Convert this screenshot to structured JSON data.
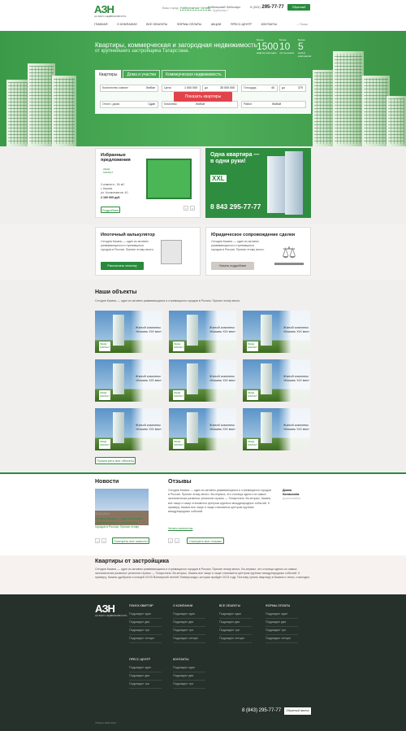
{
  "header": {
    "logo": "АЗН",
    "logo_sub": "АК БАРС НЕДВИЖИМОСТЬ",
    "city_label": "Ваш город:",
    "city_value": "Набережные Челны",
    "address": "Кобельский Лабсхирс",
    "address_sub": "Ул. Курбатова 7",
    "phone_code": "8 (843)",
    "phone": "295-77-77",
    "callback": "Обратный звонок",
    "nav": [
      "ГЛАВНАЯ",
      "О КОМПАНИИ",
      "ВСЕ ОБЪЕКТЫ",
      "ФОРМЫ ОПЛАТЫ",
      "АКЦИИ",
      "ПРЕСС-ЦЕНТР",
      "КОНТАКТЫ"
    ],
    "search": "Поиск"
  },
  "hero": {
    "title": "Квартиры, коммерческая и загородная недвижимость",
    "subtitle": "от крупнейшего застройщика Татарстана.",
    "stats": [
      {
        "label": "Более",
        "number": "1500",
        "unit": "квартир ежегодно"
      },
      {
        "label": "Более",
        "number": "10",
        "unit": "лет на рынке"
      },
      {
        "label": "Более",
        "number": "5",
        "unit": "жилых комплексов"
      }
    ],
    "tabs": [
      "Квартиры",
      "Дома и участки",
      "Коммерческая недвижимость"
    ],
    "filters": {
      "rooms_label": "Количество комнат",
      "rooms_value": "Любое",
      "price_label": "Цена",
      "price_from": "1 000 000",
      "price_to_label": "до",
      "price_to": "35 000 000",
      "area_label": "Площадь",
      "area_from": "40",
      "area_to_label": "до",
      "area_to": "370",
      "finish_label": "Отопл. дома",
      "finish_value": "Сдан",
      "complex_label": "Комплекс",
      "complex_value": "Любой",
      "district_label": "Район",
      "district_value": "Любой"
    },
    "show_button": "Показать квартиры"
  },
  "featured": {
    "title": "Избранные предложения",
    "badge": "ЛЕНД МАРКЕТ",
    "desc": "2-комнатн., 54 м2",
    "city": "г. Казань",
    "street": "ул. Космонавтов, 40",
    "price": "2 100 000 руб.",
    "more": "Подробнее"
  },
  "promo": {
    "title": "Одна квартира — в одни руки!",
    "brand": "XXL",
    "phone": "8 843 295-77-77"
  },
  "calc": {
    "title": "Ипотечный калькулятор",
    "text": "Сегодня Казань — один из активно развивающихся и стремящихся городов в России. Причин этому много.",
    "button": "Рассчитать ипотеку"
  },
  "legal": {
    "title": "Юридическое сопровождение сделки",
    "text": "Сегодня Казань — один из активно развивающихся и стремящихся городов в России. Причин этому много.",
    "button": "Узнать подробнее"
  },
  "objects": {
    "title": "Наши объекты",
    "text": "Сегодня Казань — один из активно развивающихся и стремящихся городов в России. Причин этому много.",
    "tiles": [
      {
        "name": "Жилой комплекс «Казань XXI век»"
      },
      {
        "name": "Жилой комплекс «Казань XXI век»"
      },
      {
        "name": "Жилой комплекс «Казань XXI век»"
      },
      {
        "name": "Жилой комплекс «Казань XXI век»"
      },
      {
        "name": "Жилой комплекс «Казань XXI век»"
      },
      {
        "name": "Жилой комплекс «Казань XXI век»"
      },
      {
        "name": "Жилой комплекс «Казань XXI век»"
      },
      {
        "name": "Жилой комплекс «Казань XXI век»"
      },
      {
        "name": "Жилой комплекс «Казань XXI век»"
      }
    ],
    "tile_logo": "ЛЕНД МАРКЕТ",
    "all_button": "Посмотреть все объекты"
  },
  "news": {
    "title": "Новости",
    "date": "12.04.2014",
    "text": "Сегодня Казань — один из активно развивающихся и стремящихся городов в России. Причин этому",
    "button": "Смотреть все новости"
  },
  "reviews": {
    "title": "Отзывы",
    "text": "Сегодня Казань — один из активно развивающихся и стремящихся городов в России. Причин этому много. Во-первых, это столица одного из самых экономически развитых регионов страны — Татарстана. Во-вторых, Казань все чаще и чаще становится центром крупных международных событий. К примеру, Казань все чаще и чаще становится центром крупных международных событий.",
    "link": "Читать полностью",
    "author": "Диана Калмыкова",
    "role": "Домохозяйка",
    "button": "Смотреть все отзывы"
  },
  "developer": {
    "title": "Квартиры от застройщика",
    "text": "Сегодня Казань — один из активно развивающихся и стремящихся городов в России. Причин этому много. Во-первых, это столица одного из самых экономически развитых регионов страны — Татарстана. Во-вторых, Казань все чаще и чаще становится центром крупных международных событий. К примеру, Казань удобрала столицей XXVII Всемирной летней Универсиады, которая пройдет 2013 году. Поэтому купить квартиру в Казани и легко, и выгодно."
  },
  "footer": {
    "logo": "АЗН",
    "logo_sub": "АК БАРС НЕДВИЖИМОСТЬ",
    "columns": [
      {
        "title": "ПОИСК КВАРТИР",
        "items": [
          "Подраздел один",
          "Подраздел два",
          "Подраздел три",
          "Подраздел четыре"
        ]
      },
      {
        "title": "О КОМПАНИИ",
        "items": [
          "Подраздел один",
          "Подраздел два",
          "Подраздел три",
          "Подраздел четыре"
        ]
      },
      {
        "title": "ВСЕ ОБЪЕКТЫ",
        "items": [
          "Подраздел один",
          "Подраздел два",
          "Подраздел три",
          "Подраздел четыре"
        ]
      },
      {
        "title": "ФОРМЫ ОПЛАТЫ",
        "items": [
          "Подраздел один",
          "Подраздел два",
          "Подраздел три",
          "Подраздел четыре"
        ]
      },
      {
        "title": "ПРЕСС-ЦЕНТР",
        "items": [
          "Подраздел один",
          "Подраздел два",
          "Подраздел три"
        ]
      },
      {
        "title": "КОНТАКТЫ",
        "items": [
          "Подраздел один",
          "Подраздел два",
          "Подраздел три"
        ]
      }
    ],
    "phone": "8 (843) 295-77-77",
    "callback": "Обратный звонок",
    "copyright": "©Ибрис 2000-2014"
  },
  "colors": {
    "brand": "#2a8a3c",
    "accent": "#e0434a",
    "footer": "#27312b"
  }
}
